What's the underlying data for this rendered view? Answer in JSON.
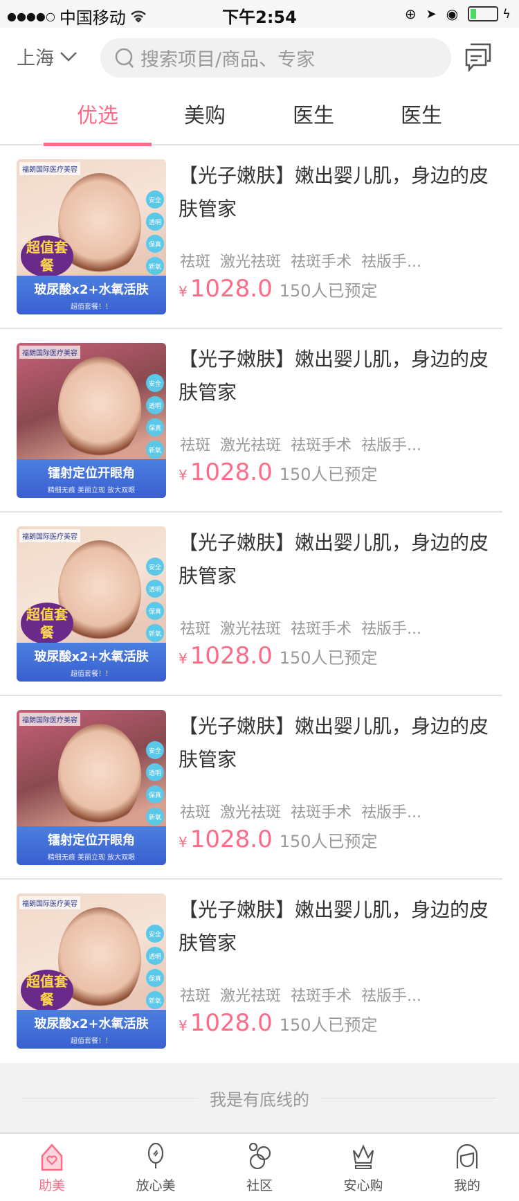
{
  "status": {
    "signal": "●●●●○",
    "carrier": "中国移动",
    "time": "下午2:54",
    "battery_percent": 20
  },
  "header": {
    "city": "上海",
    "search_placeholder": "搜索项目/商品、专家"
  },
  "tabs": [
    {
      "label": "优选",
      "active": true
    },
    {
      "label": "美购"
    },
    {
      "label": "医生"
    },
    {
      "label": "医生"
    }
  ],
  "products": [
    {
      "img": "a",
      "logo": "福朗国际医疗美容",
      "promo": "超值套餐",
      "banner": "玻尿酸x2+水氧活肤",
      "banner_sub": "超值套餐！！",
      "title": "【光子嫩肤】嫩出婴儿肌，身边的皮肤管家",
      "tags": [
        "祛斑",
        "激光祛斑",
        "祛斑手术",
        "祛版手..."
      ],
      "currency": "¥",
      "price": "1028.0",
      "booked": "150人已预定"
    },
    {
      "img": "b",
      "logo": "福朗国际医疗美容",
      "banner": "镭射定位开眼角",
      "banner_sub": "精细无痕 美丽立现 放大双眼",
      "title": "【光子嫩肤】嫩出婴儿肌，身边的皮肤管家",
      "tags": [
        "祛斑",
        "激光祛斑",
        "祛斑手术",
        "祛版手..."
      ],
      "currency": "¥",
      "price": "1028.0",
      "booked": "150人已预定"
    },
    {
      "img": "a",
      "logo": "福朗国际医疗美容",
      "promo": "超值套餐",
      "banner": "玻尿酸x2+水氧活肤",
      "banner_sub": "超值套餐！！",
      "title": "【光子嫩肤】嫩出婴儿肌，身边的皮肤管家",
      "tags": [
        "祛斑",
        "激光祛斑",
        "祛斑手术",
        "祛版手..."
      ],
      "currency": "¥",
      "price": "1028.0",
      "booked": "150人已预定"
    },
    {
      "img": "b",
      "logo": "福朗国际医疗美容",
      "banner": "镭射定位开眼角",
      "banner_sub": "精细无痕 美丽立现 放大双眼",
      "title": "【光子嫩肤】嫩出婴儿肌，身边的皮肤管家",
      "tags": [
        "祛斑",
        "激光祛斑",
        "祛斑手术",
        "祛版手..."
      ],
      "currency": "¥",
      "price": "1028.0",
      "booked": "150人已预定"
    },
    {
      "img": "a",
      "logo": "福朗国际医疗美容",
      "promo": "超值套餐",
      "banner": "玻尿酸x2+水氧活肤",
      "banner_sub": "超值套餐！！",
      "title": "【光子嫩肤】嫩出婴儿肌，身边的皮肤管家",
      "tags": [
        "祛斑",
        "激光祛斑",
        "祛斑手术",
        "祛版手..."
      ],
      "currency": "¥",
      "price": "1028.0",
      "booked": "150人已预定"
    }
  ],
  "image_badges": [
    "安全",
    "透明",
    "保真",
    "新氧"
  ],
  "footer_text": "我是有底线的",
  "tabbar": [
    {
      "label": "助美",
      "icon": "home-heart-icon",
      "active": true
    },
    {
      "label": "放心美",
      "icon": "mirror-icon"
    },
    {
      "label": "社区",
      "icon": "bubbles-icon"
    },
    {
      "label": "安心购",
      "icon": "crown-icon"
    },
    {
      "label": "我的",
      "icon": "face-icon"
    }
  ],
  "colors": {
    "accent": "#ff6b87"
  }
}
